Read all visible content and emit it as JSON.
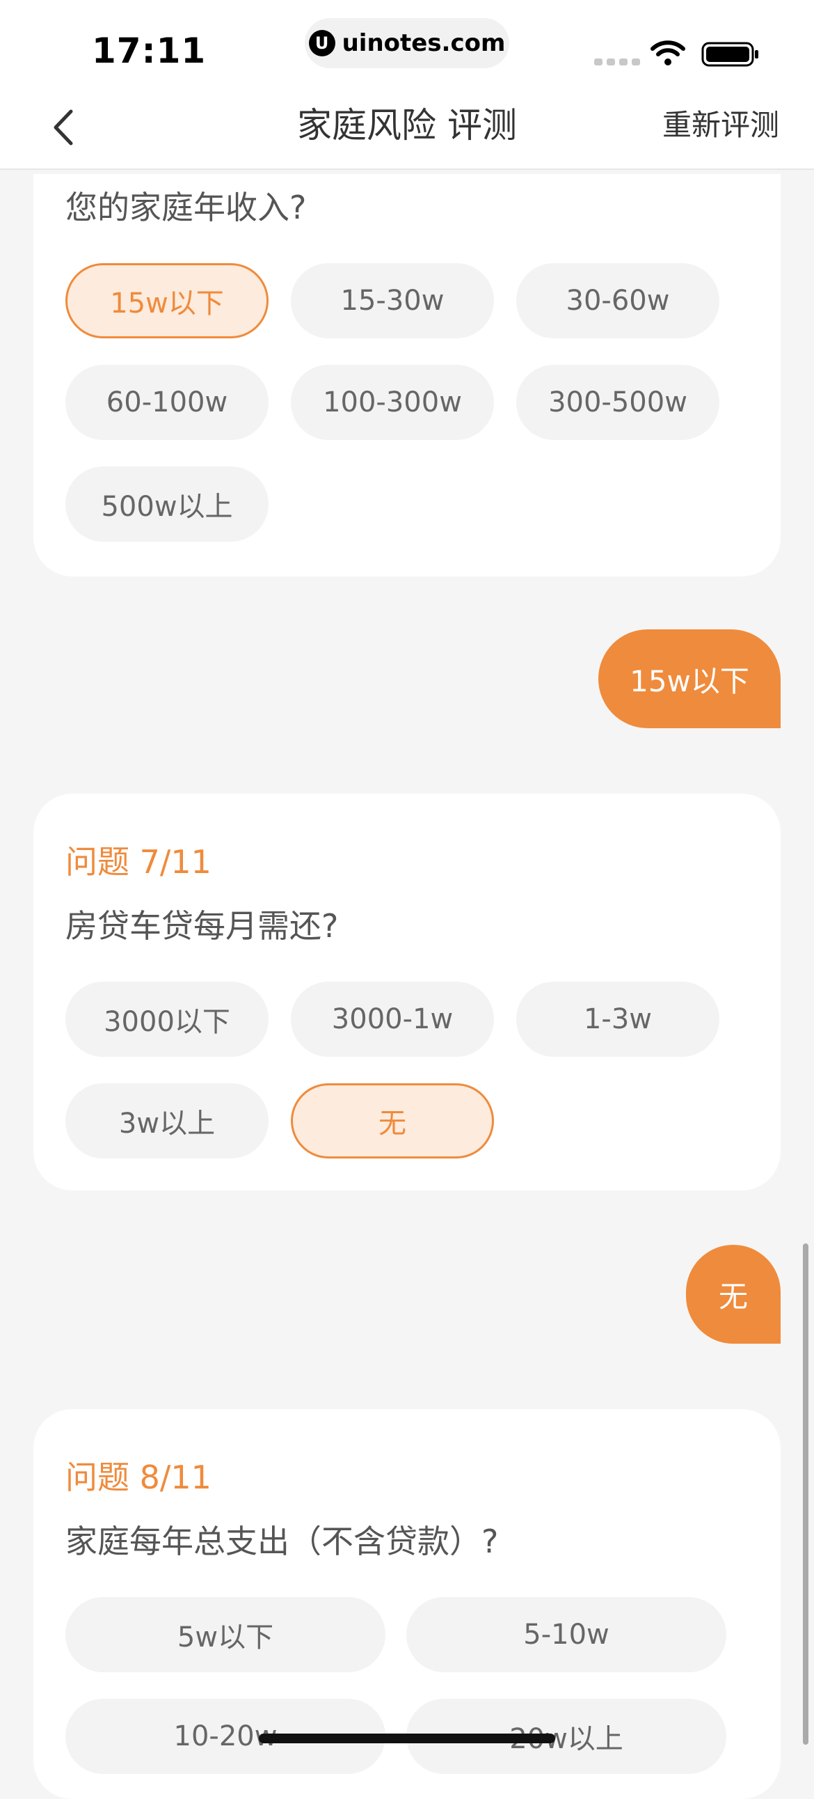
{
  "status": {
    "time": "17:11",
    "watermark": "uinotes.com",
    "watermark_logo": "U"
  },
  "nav": {
    "title": "家庭风险 评测",
    "reset": "重新评测"
  },
  "q6": {
    "question": "您的家庭年收入?",
    "options": [
      "15w以下",
      "15-30w",
      "30-60w",
      "60-100w",
      "100-300w",
      "300-500w",
      "500w以上"
    ],
    "selected": "15w以下"
  },
  "answer6": "15w以下",
  "q7": {
    "number": "问题 7/11",
    "question": "房贷车贷每月需还?",
    "options": [
      "3000以下",
      "3000-1w",
      "1-3w",
      "3w以上",
      "无"
    ],
    "selected": "无"
  },
  "answer7": "无",
  "q8": {
    "number": "问题 8/11",
    "question": "家庭每年总支出（不含贷款）?",
    "options": [
      "5w以下",
      "5-10w",
      "10-20w",
      "20w以上"
    ]
  },
  "colors": {
    "accent": "#ef8b3c",
    "selected_bg": "#fdebdd",
    "option_bg": "#f3f3f3"
  }
}
